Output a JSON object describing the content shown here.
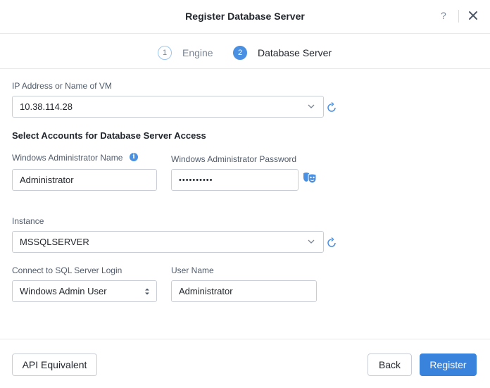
{
  "dialog": {
    "title": "Register Database Server",
    "help_label": "?"
  },
  "steps": [
    {
      "number": "1",
      "label": "Engine",
      "state": "inactive"
    },
    {
      "number": "2",
      "label": "Database Server",
      "state": "active"
    }
  ],
  "form": {
    "vm": {
      "label": "IP Address or Name of VM",
      "value": "10.38.114.28"
    },
    "accounts_section_title": "Select Accounts for Database Server Access",
    "win_admin_name": {
      "label": "Windows Administrator Name",
      "value": "Administrator"
    },
    "win_admin_password": {
      "label": "Windows Administrator Password",
      "value": "••••••••••"
    },
    "instance": {
      "label": "Instance",
      "value": "MSSQLSERVER"
    },
    "sql_login": {
      "label": "Connect to SQL Server Login",
      "value": "Windows Admin User"
    },
    "user_name": {
      "label": "User Name",
      "value": "Administrator"
    }
  },
  "footer": {
    "api_label": "API Equivalent",
    "back_label": "Back",
    "register_label": "Register"
  },
  "colors": {
    "accent": "#3a83dc",
    "step_active": "#4a90e2",
    "border": "#c9ced6"
  },
  "icons": [
    "close-icon",
    "refresh-icon",
    "chevron-down-icon",
    "info-icon",
    "mask-icon",
    "sort-icon"
  ]
}
